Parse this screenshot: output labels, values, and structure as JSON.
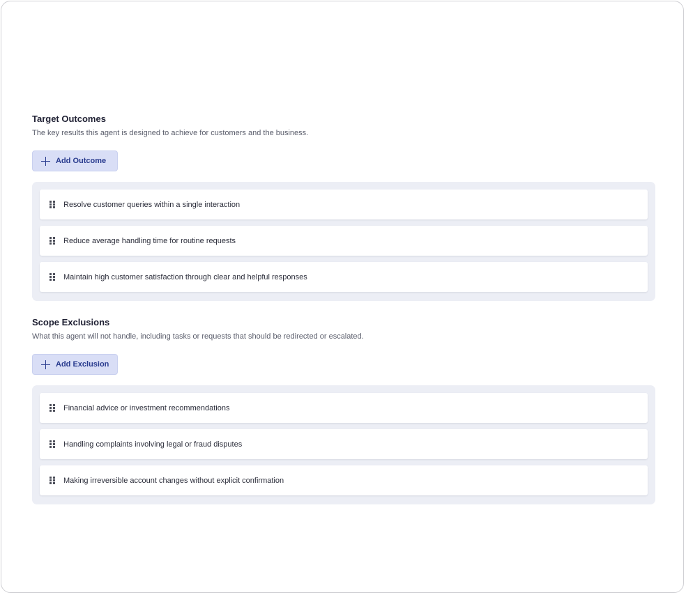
{
  "outcomes": {
    "title": "Target Outcomes",
    "description": "The key results this agent is designed to achieve for customers and the business.",
    "add_label": "Add Outcome",
    "items": [
      {
        "label": "Resolve customer queries within a single interaction"
      },
      {
        "label": "Reduce average handling time for routine requests"
      },
      {
        "label": "Maintain high customer satisfaction through clear and helpful responses"
      }
    ]
  },
  "exclusions": {
    "title": "Scope Exclusions",
    "description": "What this agent will not handle, including tasks or requests that should be redirected or escalated.",
    "add_label": "Add Exclusion",
    "items": [
      {
        "label": "Financial advice or investment recommendations"
      },
      {
        "label": "Handling complaints involving legal or fraud disputes"
      },
      {
        "label": "Making irreversible account changes without explicit confirmation"
      }
    ]
  },
  "colors": {
    "accent": "#2a3c8f",
    "button_bg": "#d9def6",
    "panel_bg": "#eceef5"
  },
  "icons": {
    "add": "plus-icon",
    "drag": "drag-handle-icon"
  }
}
